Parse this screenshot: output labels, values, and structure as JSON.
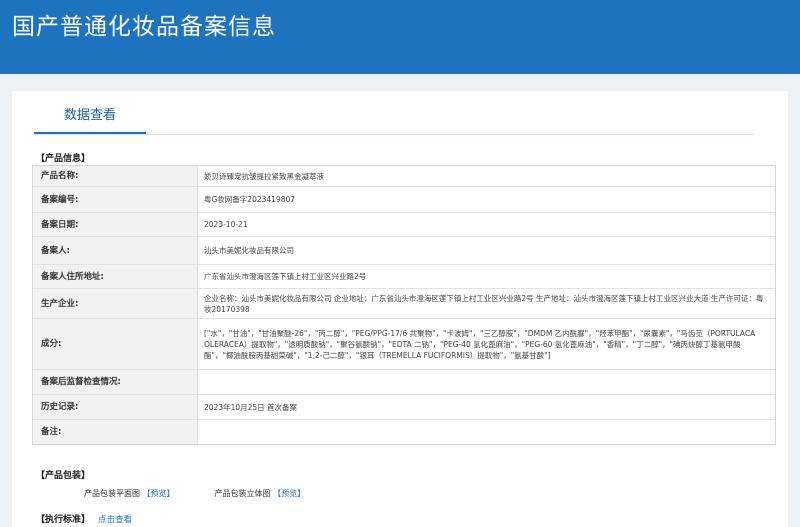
{
  "header": {
    "title": "国产普通化妆品备案信息"
  },
  "tabs": [
    {
      "label": "数据查看"
    }
  ],
  "product_info": {
    "section_label": "【产品信息】",
    "rows": [
      {
        "label": "产品名称:",
        "value": "娇贝诗臻宠抗皱提拉紧致黑金凝萃液"
      },
      {
        "label": "备案编号:",
        "value": "粤G妆网备字2023419807"
      },
      {
        "label": "备案日期:",
        "value": "2023-10-21"
      },
      {
        "label": "备案人:",
        "value": "汕头市美妮化妆品有限公司"
      },
      {
        "label": "备案人住所地址:",
        "value": "广东省汕头市澄海区莲下镇上村工业区兴业路2号"
      },
      {
        "label": "生产企业:",
        "value": "企业名称：汕头市美妮化妆品有限公司 企业地址：广东省汕头市澄海区莲下镇上村工业区兴业路2号 生产地址：汕头市澄海区莲下镇上村工业区兴业大道 生产许可证：粤妆20170398"
      },
      {
        "label": "成分:",
        "value": "[\"水\"，\"甘油\"，\"甘油聚醚-26\"，\"丙二醇\"，\"PEG/PPG-17/6 共聚物\"，\"卡波姆\"，\"三乙醇胺\"，\"DMDM 乙内酰脲\"，\"羟苯甲酯\"，\"尿囊素\"，\"马齿苋（PORTULACA OLERACEA）提取物\"，\"透明质酸钠\"，\"聚谷氨酸钠\"，\"EDTA 二钠\"，\"PEG-40 氢化蓖麻油\"，\"PEG-60 氢化蓖麻油\"，\"香精\"，\"丁二醇\"，\"碘丙炔醇丁基氨甲酸酯\"，\"椰油酰胺丙基甜菜碱\"，\"1,2-己二醇\"，\"银耳（TREMELLA FUCIFORMIS）提取物\"，\"氨基甘酸\"]"
      },
      {
        "label": "备案后监督检查情况:",
        "value": ""
      },
      {
        "label": "历史记录:",
        "value": "2023年10月25日 首次备案"
      },
      {
        "label": "备注:",
        "value": ""
      }
    ]
  },
  "packaging": {
    "section_label": "【产品包装】",
    "items": [
      {
        "label": "产品包装平面图",
        "link": "【预览】"
      },
      {
        "label": "产品包装立体图",
        "link": "【预览】"
      }
    ]
  },
  "standard": {
    "section_label": "【执行标准】",
    "link": "点击查看"
  }
}
